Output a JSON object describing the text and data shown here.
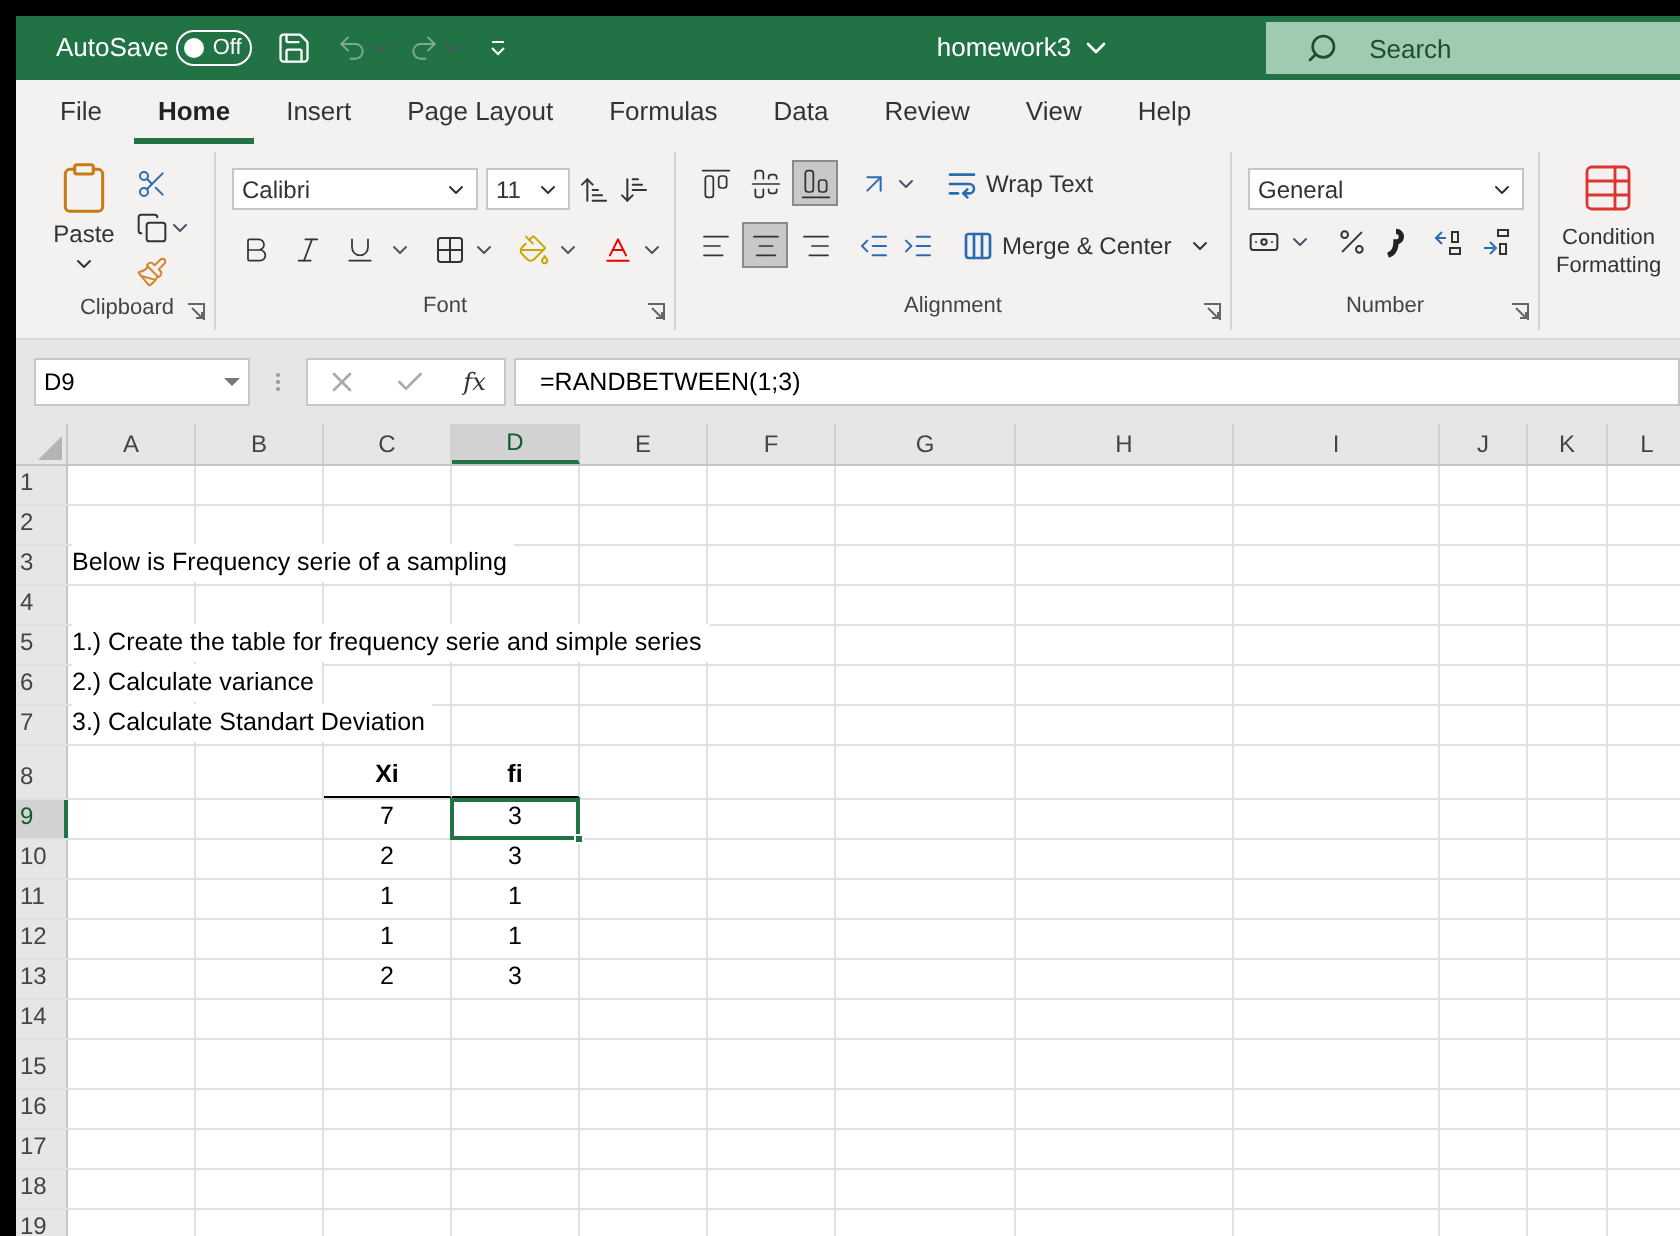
{
  "title_bar": {
    "autosave_label": "AutoSave",
    "autosave": {
      "on": false,
      "label": "Off"
    },
    "file_name": "homework3",
    "search_placeholder": "Search"
  },
  "tabs": [
    {
      "label": "File",
      "selected": false
    },
    {
      "label": "Home",
      "selected": true
    },
    {
      "label": "Insert",
      "selected": false
    },
    {
      "label": "Page Layout",
      "selected": false
    },
    {
      "label": "Formulas",
      "selected": false
    },
    {
      "label": "Data",
      "selected": false
    },
    {
      "label": "Review",
      "selected": false
    },
    {
      "label": "View",
      "selected": false
    },
    {
      "label": "Help",
      "selected": false
    }
  ],
  "ribbon": {
    "clipboard": {
      "paste": "Paste",
      "group": "Clipboard"
    },
    "font": {
      "font_name": "Calibri",
      "font_size": "11",
      "bold": false,
      "italic": false,
      "underline": false,
      "group": "Font"
    },
    "alignment": {
      "wrap_text": "Wrap Text",
      "merge": "Merge & Center",
      "group": "Alignment",
      "vertical": [
        {
          "selected": false
        },
        {
          "selected": false
        },
        {
          "selected": true
        }
      ],
      "horizontal": [
        {
          "selected": false
        },
        {
          "selected": true
        },
        {
          "selected": false
        }
      ]
    },
    "number": {
      "format": "General",
      "group": "Number"
    },
    "styles": {
      "conditional_1": "Condition",
      "conditional_2": "Formatting"
    }
  },
  "formula_bar": {
    "name_box": "D9",
    "fx": "fx",
    "formula": "=RANDBETWEEN(1;3)"
  },
  "columns": [
    {
      "label": "A",
      "selected": false
    },
    {
      "label": "B",
      "selected": false
    },
    {
      "label": "C",
      "selected": false
    },
    {
      "label": "D",
      "selected": true
    },
    {
      "label": "E",
      "selected": false
    },
    {
      "label": "F",
      "selected": false
    },
    {
      "label": "G",
      "selected": false
    },
    {
      "label": "H",
      "selected": false
    },
    {
      "label": "I",
      "selected": false
    },
    {
      "label": "J",
      "selected": false
    },
    {
      "label": "K",
      "selected": false
    },
    {
      "label": "L",
      "selected": false
    }
  ],
  "rows": [
    {
      "number": "1",
      "kind": "empty"
    },
    {
      "number": "2",
      "kind": "empty"
    },
    {
      "number": "3",
      "kind": "note",
      "text": "Below is Frequency serie of a sampling"
    },
    {
      "number": "4",
      "kind": "empty"
    },
    {
      "number": "5",
      "kind": "note",
      "text": "1.) Create the table for frequency serie and simple series"
    },
    {
      "number": "6",
      "kind": "note",
      "text": "2.) Calculate variance"
    },
    {
      "number": "7",
      "kind": "note",
      "text": "3.) Calculate Standart Deviation"
    },
    {
      "number": "8",
      "kind": "table_header",
      "xi": "Xi",
      "fi": "fi"
    },
    {
      "number": "9",
      "kind": "table_row",
      "xi": "7",
      "fi": "3",
      "selected": true
    },
    {
      "number": "10",
      "kind": "table_row",
      "xi": "2",
      "fi": "3",
      "selected": false
    },
    {
      "number": "11",
      "kind": "table_row",
      "xi": "1",
      "fi": "1",
      "selected": false
    },
    {
      "number": "12",
      "kind": "table_row",
      "xi": "1",
      "fi": "1",
      "selected": false
    },
    {
      "number": "13",
      "kind": "table_row",
      "xi": "2",
      "fi": "3",
      "selected": false
    },
    {
      "number": "14",
      "kind": "empty"
    },
    {
      "number": "15",
      "kind": "empty"
    },
    {
      "number": "16",
      "kind": "empty"
    },
    {
      "number": "17",
      "kind": "empty"
    },
    {
      "number": "18",
      "kind": "empty"
    },
    {
      "number": "19",
      "kind": "empty"
    }
  ]
}
